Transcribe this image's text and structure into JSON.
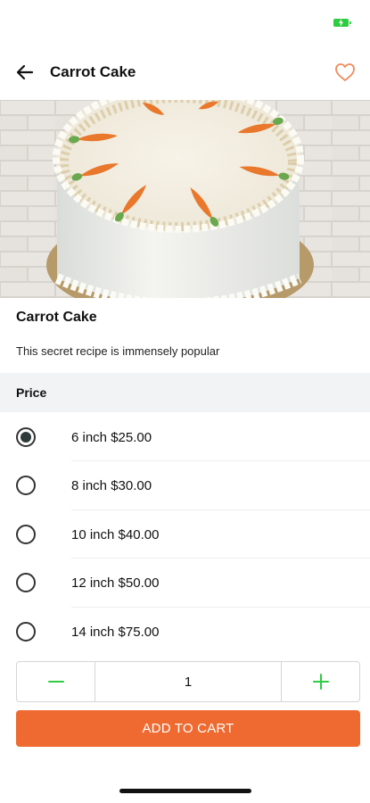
{
  "colors": {
    "accent": "#ee6a30",
    "favorite": "#f08a5a",
    "stepper": "#2ecc40",
    "battery": "#2ecc40",
    "price_header_bg": "#f2f3f5"
  },
  "icons": {
    "back": "arrow-left-icon",
    "favorite": "heart-outline-icon",
    "minus": "minus-icon",
    "plus": "plus-icon",
    "battery": "battery-charging-icon"
  },
  "nav": {
    "title": "Carrot Cake"
  },
  "product": {
    "name": "Carrot Cake",
    "description": "This secret recipe is immensely popular"
  },
  "price_section": {
    "title": "Price",
    "options": [
      {
        "label": "6 inch  $25.00",
        "selected": true
      },
      {
        "label": "8 inch  $30.00",
        "selected": false
      },
      {
        "label": "10 inch  $40.00",
        "selected": false
      },
      {
        "label": "12 inch  $50.00",
        "selected": false
      },
      {
        "label": "14 inch  $75.00",
        "selected": false
      }
    ]
  },
  "quantity": {
    "value": "1"
  },
  "cart": {
    "button_label": "ADD TO CART"
  }
}
